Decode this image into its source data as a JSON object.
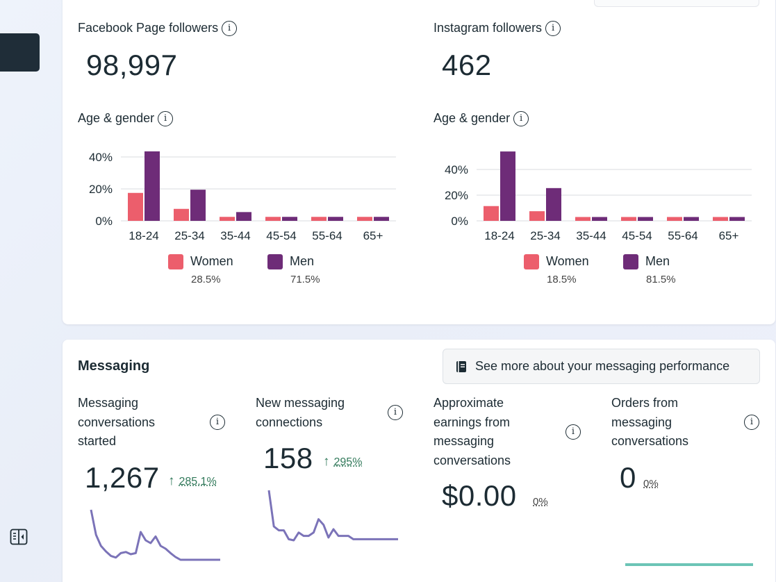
{
  "colors": {
    "women": "#ec5e6c",
    "men": "#6e2c78",
    "sparkline": "#7b73b8",
    "flatline": "#6cc4b6",
    "up": "#31795a"
  },
  "facebook": {
    "title": "Facebook Page followers",
    "count": "98,997",
    "age_gender_label": "Age & gender",
    "legend": {
      "women_label": "Women",
      "women_pct": "28.5%",
      "men_label": "Men",
      "men_pct": "71.5%"
    }
  },
  "instagram": {
    "title": "Instagram followers",
    "count": "462",
    "age_gender_label": "Age & gender",
    "legend": {
      "women_label": "Women",
      "women_pct": "18.5%",
      "men_label": "Men",
      "men_pct": "81.5%"
    }
  },
  "chart_data": [
    {
      "type": "bar",
      "categories": [
        "18-24",
        "25-34",
        "35-44",
        "45-54",
        "55-64",
        "65+"
      ],
      "series": [
        {
          "name": "Women",
          "values": [
            17.5,
            7.5,
            2.5,
            2.5,
            2.5,
            2.5
          ]
        },
        {
          "name": "Men",
          "values": [
            43.5,
            19.5,
            5.5,
            2.5,
            2.5,
            2.5
          ]
        }
      ],
      "yticks": [
        "0%",
        "20%",
        "40%"
      ],
      "ylim": [
        0,
        40
      ],
      "grid": true,
      "legend": "bottom"
    },
    {
      "type": "bar",
      "categories": [
        "18-24",
        "25-34",
        "35-44",
        "45-54",
        "55-64",
        "65+"
      ],
      "series": [
        {
          "name": "Women",
          "values": [
            11.5,
            7.5,
            3,
            3,
            3,
            3
          ]
        },
        {
          "name": "Men",
          "values": [
            54,
            25.5,
            3,
            3,
            3,
            3
          ]
        }
      ],
      "yticks": [
        "0%",
        "20%",
        "40%"
      ],
      "ylim": [
        0,
        40
      ],
      "grid": true,
      "legend": "bottom"
    }
  ],
  "messaging": {
    "title": "Messaging",
    "see_more": "See more about your messaging performance",
    "metrics": [
      {
        "label": "Messaging conversations started",
        "value": "1,267",
        "change": "285.1%",
        "trend": [
          100,
          55,
          35,
          25,
          17,
          14,
          22,
          24,
          20,
          22,
          60,
          45,
          40,
          52,
          35,
          30,
          22,
          15,
          10,
          10,
          10,
          10,
          10,
          10,
          10,
          10,
          10
        ]
      },
      {
        "label": "New messaging connections",
        "value": "158",
        "change": "295%",
        "trend": [
          100,
          35,
          28,
          28,
          12,
          10,
          24,
          18,
          18,
          24,
          48,
          38,
          15,
          30,
          18,
          18,
          18,
          12,
          12,
          12,
          12,
          12,
          12,
          12,
          12,
          12,
          12
        ]
      },
      {
        "label": "Approximate earnings from messaging conversations",
        "value": "$0.00",
        "change": "0%"
      },
      {
        "label": "Orders from messaging conversations",
        "value": "0",
        "change": "0%"
      }
    ]
  }
}
